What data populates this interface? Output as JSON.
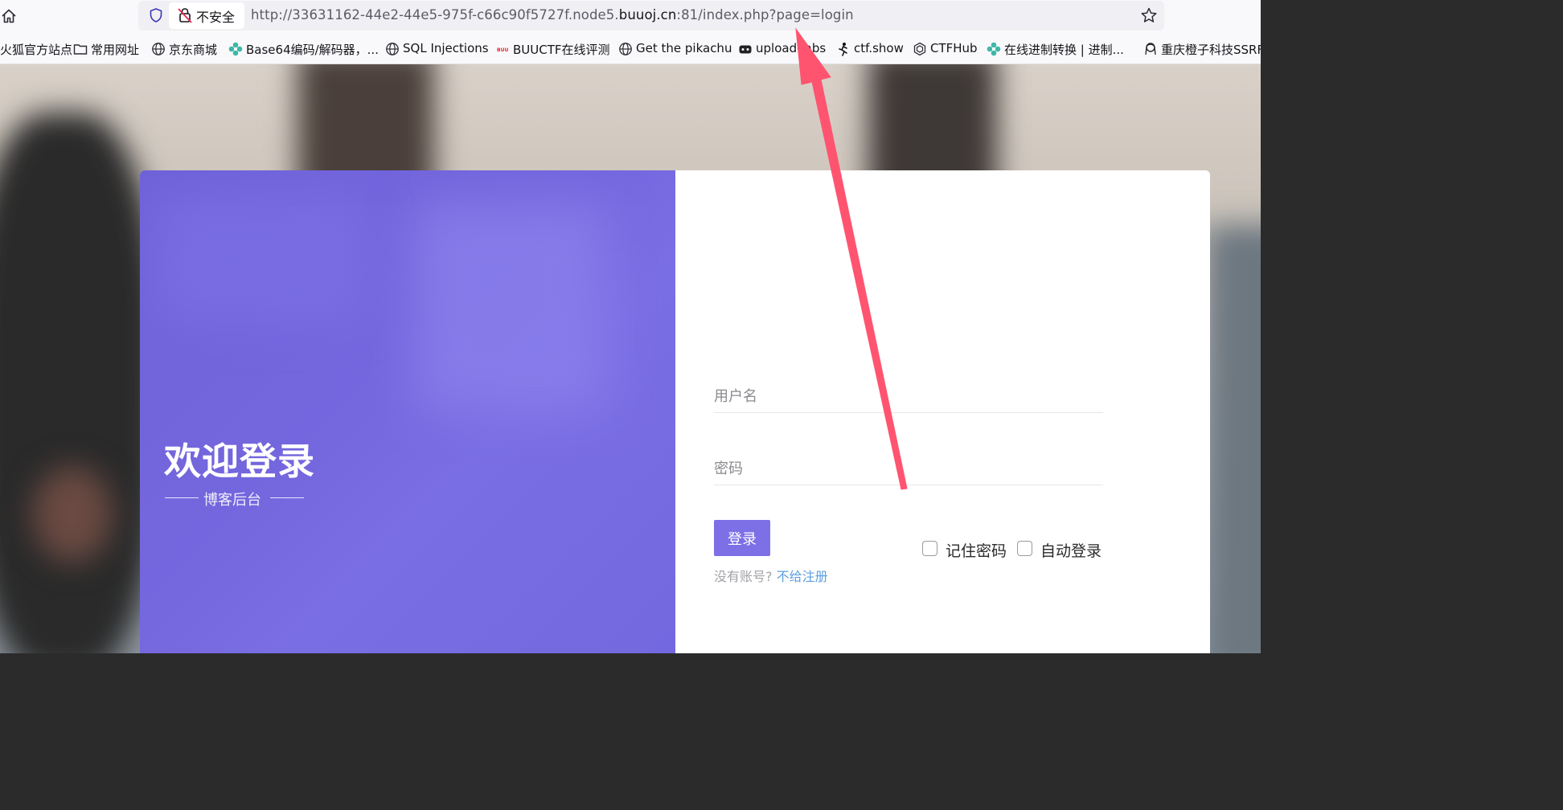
{
  "browser": {
    "security_label": "不安全",
    "url_prefix": "http://33631162-44e2-44e5-975f-c66c90f5727f.node5.",
    "url_domain": "buuoj.cn",
    "url_suffix": ":81/index.php?page=login"
  },
  "bookmarks": [
    {
      "label": "火狐官方站点",
      "icon": "firefox-icon"
    },
    {
      "label": "常用网址",
      "icon": "folder-icon"
    },
    {
      "label": "京东商城",
      "icon": "globe-icon"
    },
    {
      "label": "Base64编码/解码器，...",
      "icon": "flower-icon"
    },
    {
      "label": "SQL Injections",
      "icon": "globe-icon"
    },
    {
      "label": "BUUCTF在线评测",
      "icon": "buuctf-icon"
    },
    {
      "label": "Get the pikachu",
      "icon": "globe-icon"
    },
    {
      "label": "upload-labs",
      "icon": "console-icon"
    },
    {
      "label": "ctf.show",
      "icon": "runner-icon"
    },
    {
      "label": "CTFHub",
      "icon": "hex-icon"
    },
    {
      "label": "在线进制转换 | 进制...",
      "icon": "flower-icon"
    },
    {
      "label": "重庆橙子科技SSRF",
      "icon": "avatar-icon"
    }
  ],
  "login": {
    "welcome_title": "欢迎登录",
    "subtitle": "博客后台",
    "username_placeholder": "用户名",
    "password_placeholder": "密码",
    "login_button": "登录",
    "remember_password": "记住密码",
    "auto_login": "自动登录",
    "no_account_text": "没有账号?",
    "register_link": "不给注册"
  },
  "colors": {
    "panel_purple": "#7466dd",
    "button_purple": "#7d6fe6",
    "link_blue": "#5c9fe0",
    "arrow_red": "#ff4f6b"
  }
}
